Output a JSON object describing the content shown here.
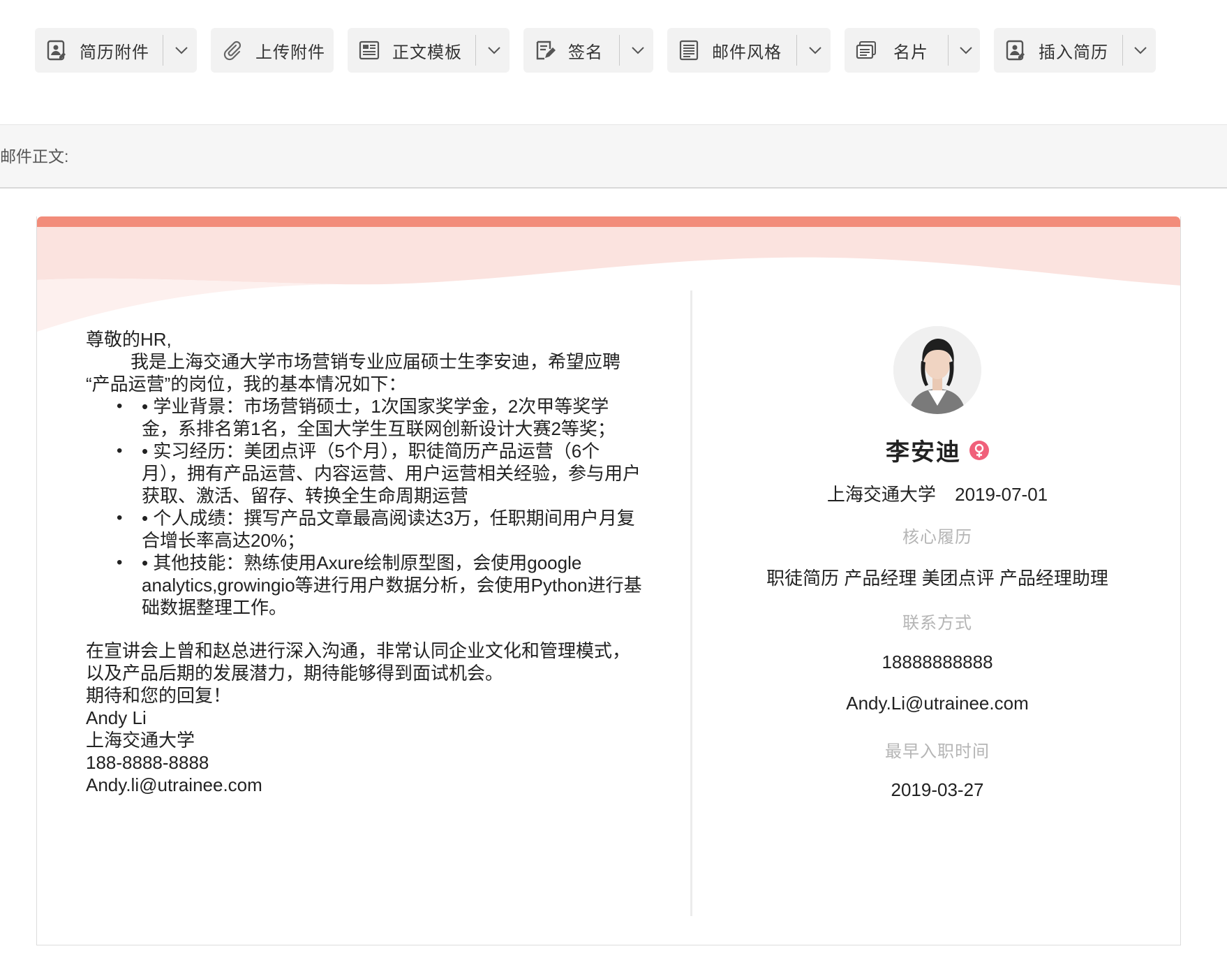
{
  "toolbar": {
    "buttons": [
      {
        "label": "简历附件",
        "icon": "resume-attachment-icon",
        "dropdown": true
      },
      {
        "label": "上传附件",
        "icon": "paperclip-icon",
        "dropdown": false
      },
      {
        "label": "正文模板",
        "icon": "template-icon",
        "dropdown": true
      },
      {
        "label": "签名",
        "icon": "signature-icon",
        "dropdown": true
      },
      {
        "label": "邮件风格",
        "icon": "mail-style-icon",
        "dropdown": true
      },
      {
        "label": "名片",
        "icon": "business-card-icon",
        "dropdown": true
      },
      {
        "label": "插入简历",
        "icon": "insert-resume-icon",
        "dropdown": true
      }
    ]
  },
  "mail_body": {
    "label": "邮件正文:"
  },
  "letter": {
    "greeting": "尊敬的HR,",
    "intro": "我是上海交通大学市场营销专业应届硕士生李安迪，希望应聘 “产品运营”的岗位，我的基本情况如下：",
    "bullets": [
      "• 学业背景：市场营销硕士，1次国家奖学金，2次甲等奖学金，系排名第1名，全国大学生互联网创新设计大赛2等奖；",
      "• 实习经历：美团点评（5个月），职徒简历产品运营（6个月），拥有产品运营、内容运营、用户运营相关经验，参与用户获取、激活、留存、转换全生命周期运营",
      "• 个人成绩：撰写产品文章最高阅读达3万，任职期间用户月复合增长率高达20%；",
      "• 其他技能：熟练使用Axure绘制原型图，会使用google analytics,growingio等进行用户数据分析，会使用Python进行基础数据整理工作。"
    ],
    "closing": "在宣讲会上曾和赵总进行深入沟通，非常认同企业文化和管理模式，以及产品后期的发展潜力，期待能够得到面试机会。",
    "thanks": "期待和您的回复！",
    "signature": {
      "name": "Andy Li",
      "school": "上海交通大学",
      "phone": "188-8888-8888",
      "email": "Andy.li@utrainee.com"
    }
  },
  "profile": {
    "avatar_icon": "avatar-photo",
    "name": "李安迪",
    "gender_icon": "female-icon",
    "school": "上海交通大学",
    "graduation_date": "2019-07-01",
    "core_title": "核心履历",
    "core_value": "职徒简历 产品经理 美团点评 产品经理助理",
    "contact_title": "联系方式",
    "phone": "18888888888",
    "email": "Andy.Li@utrainee.com",
    "start_title": "最早入职时间",
    "start_date": "2019-03-27"
  },
  "colors": {
    "accent": "#f28c7a",
    "wave_light": "#fbe3df",
    "female": "#f0607a"
  }
}
